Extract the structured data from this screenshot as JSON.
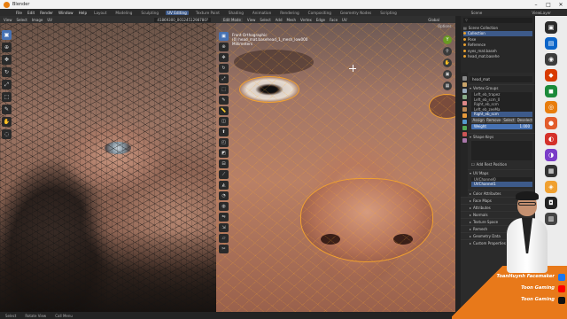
{
  "window": {
    "title": "Blender",
    "minimize": "–",
    "maximize": "□",
    "close": "✕"
  },
  "menu": {
    "items": [
      "File",
      "Edit",
      "Render",
      "Window",
      "Help"
    ],
    "workspaces": [
      "Layout",
      "Modeling",
      "Sculpting",
      "UV Editing",
      "Texture Paint",
      "Shading",
      "Animation",
      "Rendering",
      "Compositing",
      "Geometry Nodes",
      "Scripting"
    ],
    "active_workspace": "UV Editing",
    "scene": "Scene",
    "view_layer": "ViewLayer"
  },
  "uv_editor": {
    "header_items": [
      "View",
      "Select",
      "Image",
      "UV"
    ],
    "image_name": "41869300_0012451298780?"
  },
  "viewport": {
    "mode": "Edit Mode",
    "header_items": [
      "View",
      "Select",
      "Add",
      "Mesh",
      "Vertex",
      "Edge",
      "Face",
      "UV"
    ],
    "orientation": "Global",
    "overlay_info": [
      "Front Orthographic",
      "(0) head_mat.basehead_1_mesh_low000",
      "Millimeters"
    ],
    "options_label": "Options"
  },
  "outliner": {
    "search_placeholder": "",
    "items": [
      {
        "label": "Scene Collection"
      },
      {
        "label": "Collection"
      },
      {
        "label": "Pose"
      },
      {
        "label": "Reference"
      },
      {
        "label": "eyes_mat.baseh"
      },
      {
        "label": "head_mat.basehe"
      }
    ]
  },
  "properties": {
    "object_name": "head_mat",
    "vertex_groups_label": "Vertex Groups",
    "vertex_groups": [
      "Left_eb_trapez",
      "Left_eb_scm_0",
      "Right_eb_scm",
      "Left_eb_zeeMa",
      "Right_eb_scm"
    ],
    "vg_buttons": [
      "Assign",
      "Remove",
      "Select",
      "Deselect"
    ],
    "weight_label": "Weight",
    "weight_value": "1.000",
    "shape_keys_label": "Shape Keys",
    "add_rest_position": "Add Rest Position",
    "uv_maps_label": "UV Maps",
    "uv_maps": [
      "UVChannel0",
      "UVChannel1"
    ],
    "sections": [
      "Color Attributes",
      "Face Maps",
      "Attributes",
      "Normals",
      "Texture Space",
      "Remesh",
      "Geometry Data",
      "Custom Properties"
    ]
  },
  "statusbar": {
    "items": [
      "Select",
      "Rotate View",
      "Call Menu"
    ]
  },
  "overlay": {
    "channel_name": "ToanHuynh Facemaker",
    "brand_1": "Toon Gaming",
    "brand_2": "Toon Gaming"
  },
  "colors": {
    "accent": "#4772b3",
    "selection_orange": "#f0a030",
    "overlay_orange": "#e8791a"
  }
}
